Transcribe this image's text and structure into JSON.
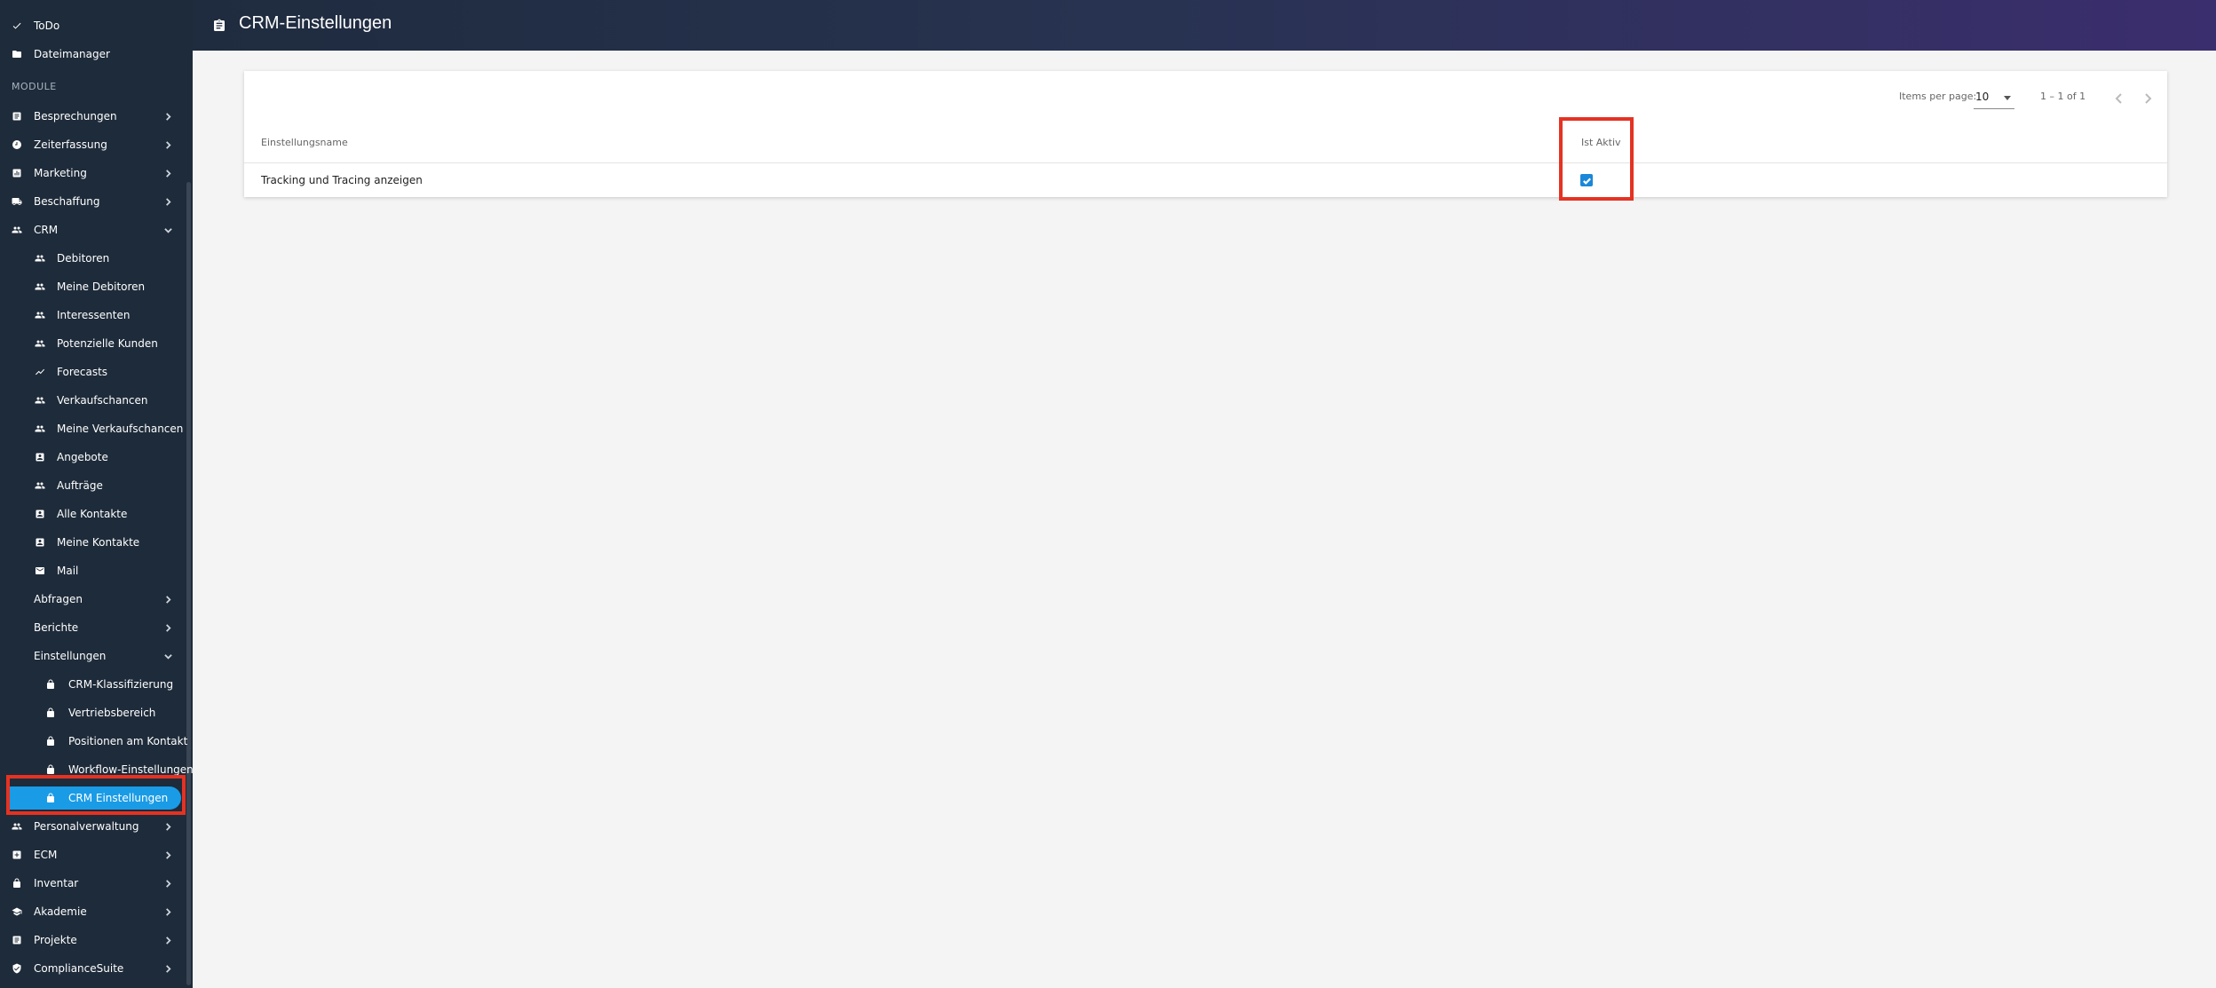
{
  "sidebar": {
    "top_items": [
      {
        "label": "ToDo",
        "icon": "check-icon"
      },
      {
        "label": "Dateimanager",
        "icon": "folder-icon"
      }
    ],
    "section_label": "MODULE",
    "modules": [
      {
        "label": "Besprechungen",
        "icon": "meeting-icon"
      },
      {
        "label": "Zeiterfassung",
        "icon": "clock-icon"
      },
      {
        "label": "Marketing",
        "icon": "marketing-icon"
      },
      {
        "label": "Beschaffung",
        "icon": "truck-icon"
      },
      {
        "label": "CRM",
        "icon": "people-icon"
      }
    ],
    "crm_children": [
      {
        "label": "Debitoren",
        "icon": "people-icon"
      },
      {
        "label": "Meine Debitoren",
        "icon": "people-icon"
      },
      {
        "label": "Interessenten",
        "icon": "people-icon"
      },
      {
        "label": "Potenzielle Kunden",
        "icon": "people-icon"
      },
      {
        "label": "Forecasts",
        "icon": "trend-icon"
      },
      {
        "label": "Verkaufschancen",
        "icon": "people-icon"
      },
      {
        "label": "Meine Verkaufschancen",
        "icon": "people-icon"
      },
      {
        "label": "Angebote",
        "icon": "contact-card-icon"
      },
      {
        "label": "Aufträge",
        "icon": "people-icon"
      },
      {
        "label": "Alle Kontakte",
        "icon": "contact-card-icon"
      },
      {
        "label": "Meine Kontakte",
        "icon": "contact-card-icon"
      },
      {
        "label": "Mail",
        "icon": "mail-icon"
      },
      {
        "label": "Abfragen"
      },
      {
        "label": "Berichte"
      },
      {
        "label": "Einstellungen"
      }
    ],
    "settings_children": [
      {
        "label": "CRM-Klassifizierung",
        "icon": "lock-icon"
      },
      {
        "label": "Vertriebsbereich",
        "icon": "lock-icon"
      },
      {
        "label": "Positionen am Kontakt",
        "icon": "lock-icon"
      },
      {
        "label": "Workflow-Einstellungen",
        "icon": "lock-icon"
      },
      {
        "label": "CRM Einstellungen",
        "icon": "lock-icon",
        "active": true
      }
    ],
    "bottom_modules": [
      {
        "label": "Personalverwaltung",
        "icon": "people-icon"
      },
      {
        "label": "ECM",
        "icon": "ecm-icon"
      },
      {
        "label": "Inventar",
        "icon": "lock-icon"
      },
      {
        "label": "Akademie",
        "icon": "school-icon"
      },
      {
        "label": "Projekte",
        "icon": "project-icon"
      },
      {
        "label": "ComplianceSuite",
        "icon": "shield-icon"
      }
    ]
  },
  "header": {
    "title": "CRM-Einstellungen",
    "icon": "clipboard-icon"
  },
  "table": {
    "paginator": {
      "items_per_page_label": "Items per page:",
      "items_per_page_value": "10",
      "range_label": "1 – 1 of 1"
    },
    "columns": [
      "Einstellungsname",
      "Ist Aktiv"
    ],
    "rows": [
      {
        "name": "Tracking und Tracing anzeigen",
        "active": true
      }
    ]
  },
  "colors": {
    "sidebar_bg": "#1e2b3a",
    "active_item": "#1a9be6",
    "highlight": "#e53222",
    "checkbox": "#1a87d9"
  }
}
